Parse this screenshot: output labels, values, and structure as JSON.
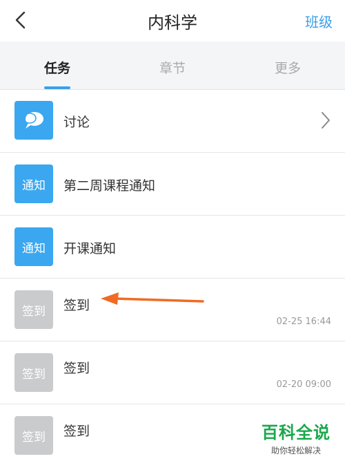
{
  "header": {
    "title": "内科学",
    "right_button": "班级"
  },
  "tabs": [
    {
      "label": "任务",
      "active": true
    },
    {
      "label": "章节",
      "active": false
    },
    {
      "label": "更多",
      "active": false
    }
  ],
  "items": [
    {
      "icon_text": "",
      "icon": "chat-bubble-icon",
      "icon_color": "#3aa7f0",
      "label": "讨论",
      "time": "",
      "has_chevron": true
    },
    {
      "icon_text": "通知",
      "icon": "notice-icon",
      "icon_color": "#3aa7f0",
      "label": "第二周课程通知",
      "time": ""
    },
    {
      "icon_text": "通知",
      "icon": "notice-icon",
      "icon_color": "#3aa7f0",
      "label": "开课通知",
      "time": ""
    },
    {
      "icon_text": "签到",
      "icon": "checkin-icon",
      "icon_color": "#c9cbcd",
      "label": "签到",
      "time": "02-25 16:44"
    },
    {
      "icon_text": "签到",
      "icon": "checkin-icon",
      "icon_color": "#c9cbcd",
      "label": "签到",
      "time": "02-20 09:00"
    },
    {
      "icon_text": "签到",
      "icon": "checkin-icon",
      "icon_color": "#c9cbcd",
      "label": "签到",
      "time": ""
    }
  ],
  "watermark": {
    "title": "百科全说",
    "subtitle": "助你轻松解决"
  },
  "colors": {
    "accent": "#3a9fea",
    "arrow": "#f06a24",
    "watermark": "#1aa84a"
  }
}
